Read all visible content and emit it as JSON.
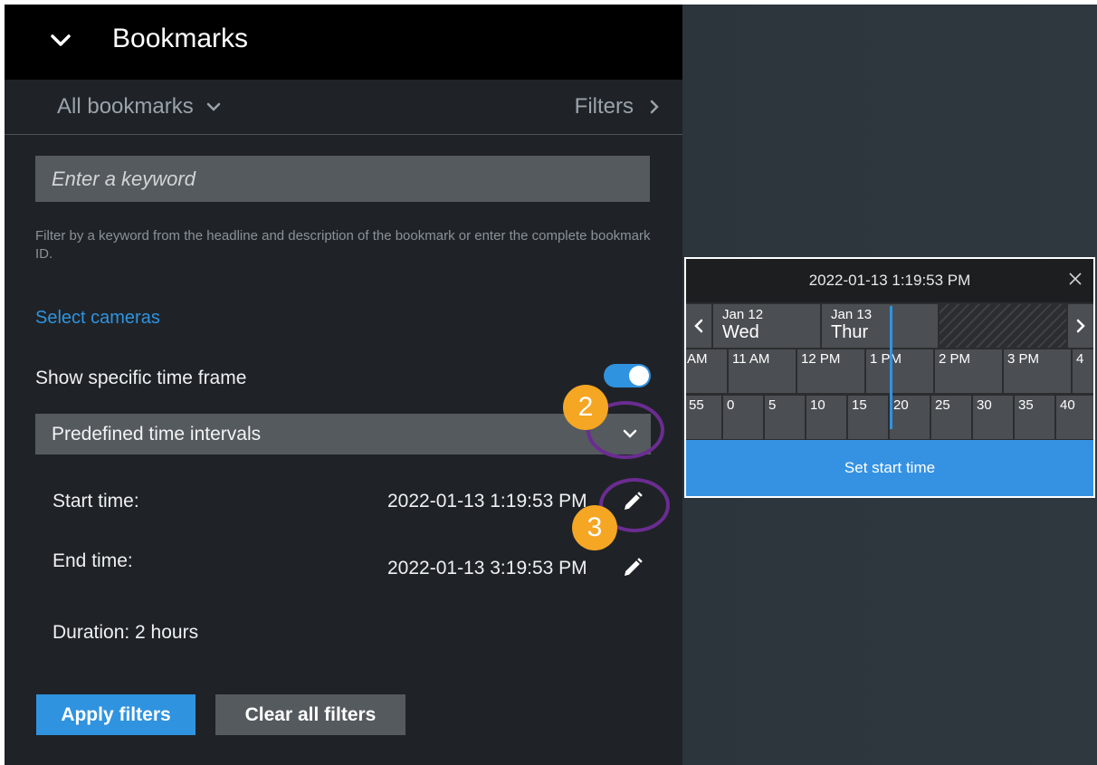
{
  "header": {
    "title": "Bookmarks",
    "collapse_icon": "chevron-down-icon"
  },
  "subheader": {
    "all_bookmarks": "All bookmarks",
    "filters": "Filters"
  },
  "search": {
    "placeholder": "Enter a keyword"
  },
  "help_text": "Filter by a keyword from the headline and description of the bookmark or enter the complete bookmark ID.",
  "select_cameras": "Select cameras",
  "time_frame": {
    "label": "Show specific time frame",
    "enabled": true
  },
  "interval": {
    "selected": "Predefined time intervals"
  },
  "start": {
    "label": "Start time:",
    "value": "2022-01-13 1:19:53 PM"
  },
  "end": {
    "label": "End time:",
    "value": "2022-01-13 3:19:53 PM"
  },
  "duration": "Duration: 2 hours",
  "buttons": {
    "apply": "Apply filters",
    "clear": "Clear all filters"
  },
  "callouts": {
    "two": "2",
    "three": "3"
  },
  "picker": {
    "title": "2022-01-13 1:19:53 PM",
    "days": [
      {
        "date": "Jan 12",
        "name": "Wed"
      },
      {
        "date": "Jan 13",
        "name": "Thur"
      }
    ],
    "hours": [
      "AM",
      "11 AM",
      "12 PM",
      "1 PM",
      "2 PM",
      "3 PM",
      "4"
    ],
    "minutes": [
      "55",
      "0",
      "5",
      "10",
      "15",
      "20",
      "25",
      "30",
      "35",
      "40"
    ],
    "set_start": "Set start time"
  },
  "colors": {
    "accent": "#2f93e0",
    "callout": "#f5a623",
    "ring": "#6b2c91"
  }
}
